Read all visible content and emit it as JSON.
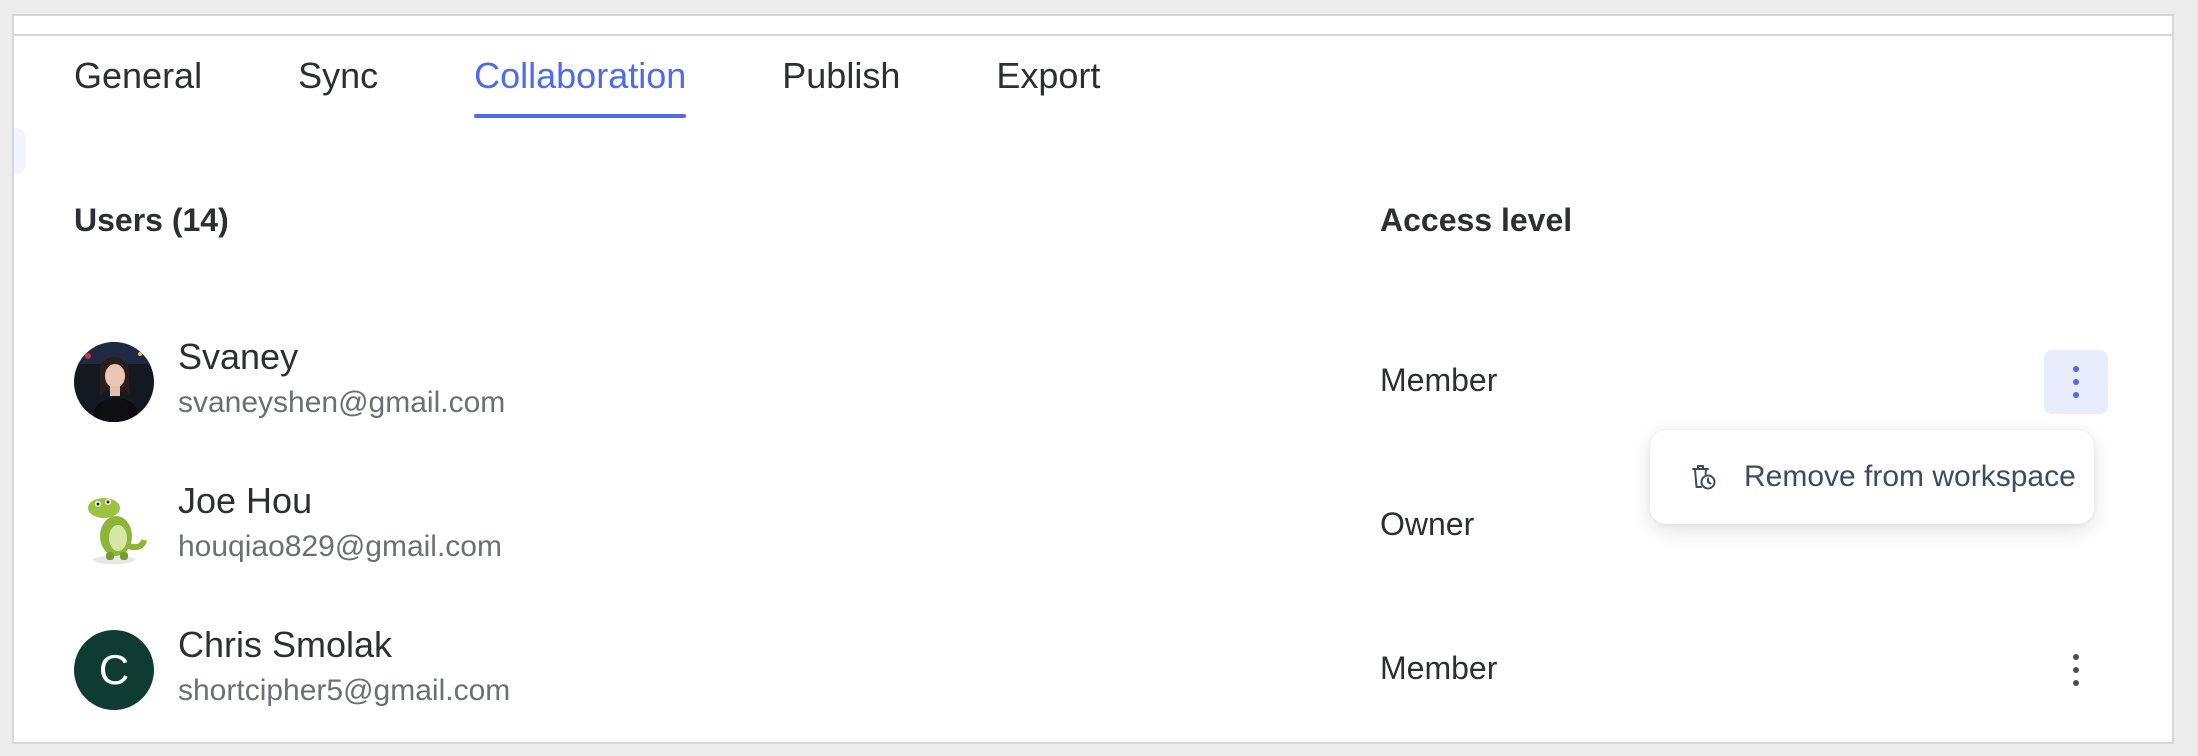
{
  "tabs": [
    {
      "label": "General",
      "active": false
    },
    {
      "label": "Sync",
      "active": false
    },
    {
      "label": "Collaboration",
      "active": true
    },
    {
      "label": "Publish",
      "active": false
    },
    {
      "label": "Export",
      "active": false
    }
  ],
  "table": {
    "users_header": "Users (14)",
    "access_header": "Access level"
  },
  "users": [
    {
      "name": "Svaney",
      "email": "svaneyshen@gmail.com",
      "access": "Member",
      "avatar": "photo-avatar",
      "menu_open": true
    },
    {
      "name": "Joe Hou",
      "email": "houqiao829@gmail.com",
      "access": "Owner",
      "avatar": "dinosaur-avatar",
      "menu_open": false
    },
    {
      "name": "Chris Smolak",
      "email": "shortcipher5@gmail.com",
      "access": "Member",
      "avatar_initial": "C",
      "avatar_color": "#0f3c32",
      "menu_open": false
    }
  ],
  "context_menu": {
    "items": [
      {
        "label": "Remove from workspace",
        "icon": "trash-clock-icon"
      }
    ]
  },
  "colors": {
    "accent": "#4f6bea",
    "accent_bg": "#e8ecfd"
  }
}
